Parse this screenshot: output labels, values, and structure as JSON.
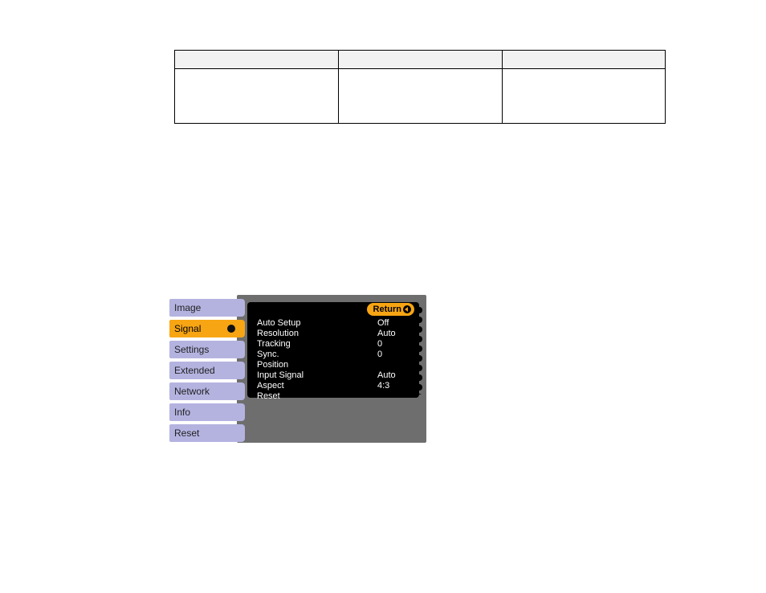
{
  "table": {
    "headers": [
      "",
      "",
      ""
    ],
    "row": [
      "",
      "",
      ""
    ]
  },
  "menu": {
    "sidebar": [
      {
        "label": "Image",
        "active": false
      },
      {
        "label": "Signal",
        "active": true
      },
      {
        "label": "Settings",
        "active": false
      },
      {
        "label": "Extended",
        "active": false
      },
      {
        "label": "Network",
        "active": false
      },
      {
        "label": "Info",
        "active": false
      },
      {
        "label": "Reset",
        "active": false
      }
    ],
    "return_label": "Return",
    "settings": [
      {
        "label": "Auto Setup",
        "value": "Off"
      },
      {
        "label": "Resolution",
        "value": "Auto"
      },
      {
        "label": "Tracking",
        "value": "0"
      },
      {
        "label": "Sync.",
        "value": "0"
      },
      {
        "label": "Position",
        "value": ""
      },
      {
        "label": "Input Signal",
        "value": "Auto"
      },
      {
        "label": "Aspect",
        "value": "4:3"
      },
      {
        "label": "Reset",
        "value": ""
      }
    ]
  }
}
